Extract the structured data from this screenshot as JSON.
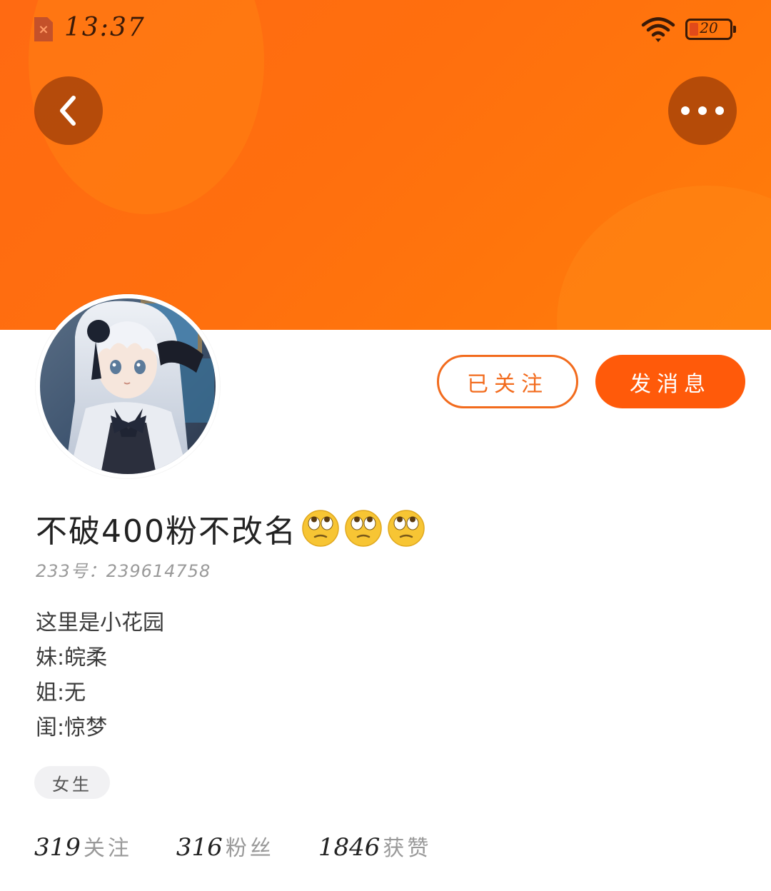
{
  "status_bar": {
    "time": "13:37",
    "battery_level": "20",
    "battery_color": "#e14a1a"
  },
  "header": {
    "back_icon": "chevron-left-icon",
    "more_icon": "more-horizontal-icon",
    "banner_color": "#ff6f0e"
  },
  "actions": {
    "followed_label": "已关注",
    "message_label": "发消息",
    "accent_color": "#ff5a0a"
  },
  "profile": {
    "name": "不破400粉不改名",
    "name_emojis": [
      "🙄",
      "🙄",
      "🙄"
    ],
    "uid_text": "233号：239614758",
    "bio_lines": [
      "这里是小花园",
      "妹:皖柔",
      "姐:无",
      "闺:惊梦"
    ],
    "tag": "女生"
  },
  "stats": [
    {
      "value": "319",
      "label": "关注"
    },
    {
      "value": "316",
      "label": "粉丝"
    },
    {
      "value": "1846",
      "label": "获赞"
    }
  ]
}
